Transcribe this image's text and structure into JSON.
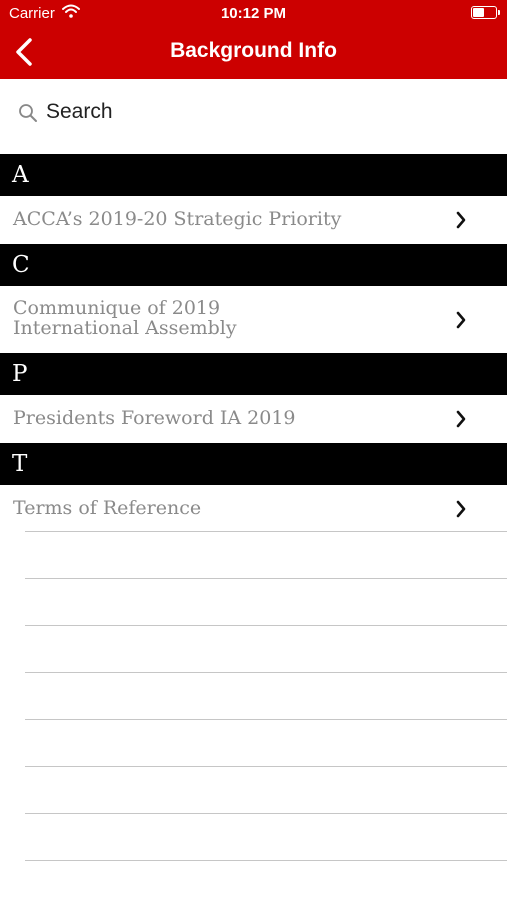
{
  "status_bar": {
    "carrier": "Carrier",
    "time": "10:12 PM",
    "icons": [
      "wifi-icon",
      "battery-icon"
    ],
    "battery_level": 0.45
  },
  "nav": {
    "title": "Background Info",
    "back_icon": "chevron-left-icon"
  },
  "search": {
    "placeholder": "Search",
    "icon": "search-icon"
  },
  "sections": [
    {
      "letter": "A",
      "items": [
        {
          "label": "ACCA’s 2019-20 Strategic Priority"
        }
      ]
    },
    {
      "letter": "C",
      "items": [
        {
          "label": "Communique of 2019\nInternational Assembly"
        }
      ]
    },
    {
      "letter": "P",
      "items": [
        {
          "label": "Presidents Foreword IA 2019"
        }
      ]
    },
    {
      "letter": "T",
      "items": [
        {
          "label": "Terms of Reference"
        }
      ]
    }
  ],
  "colors": {
    "header_red": "#cc0000",
    "section_black": "#000000",
    "item_text": "#8a8a8a",
    "separator": "#c6c6c6"
  }
}
